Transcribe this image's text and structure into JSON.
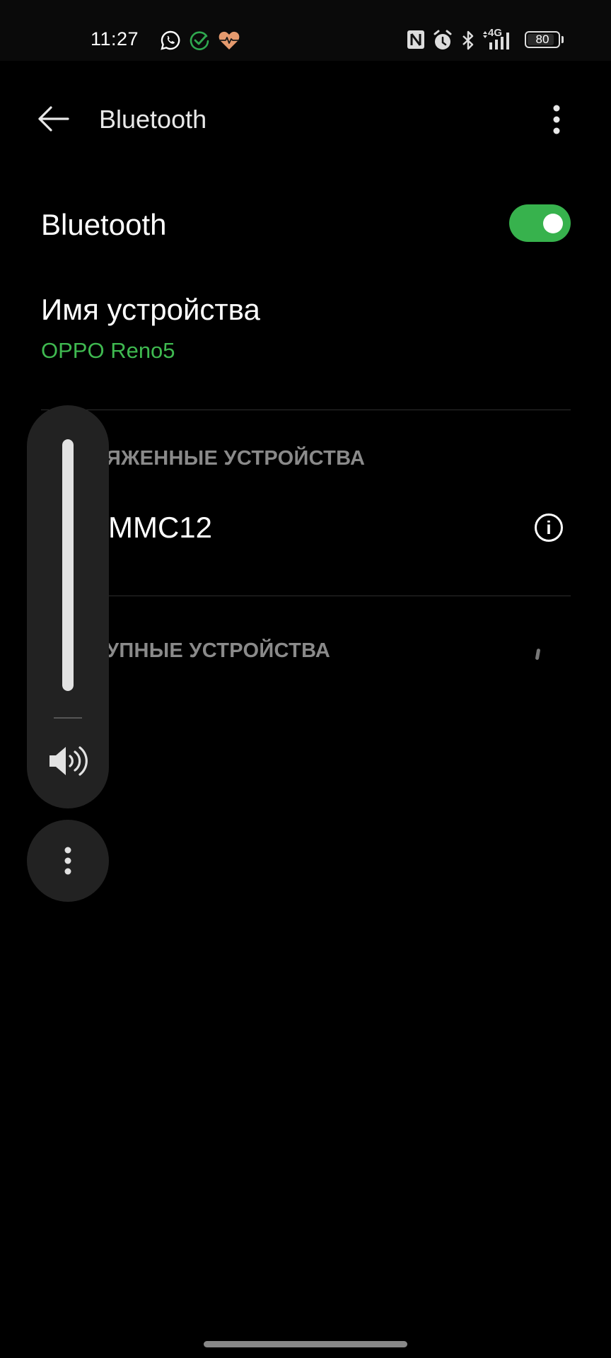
{
  "status_bar": {
    "time": "11:27",
    "notification_icons": [
      "whatsapp-icon",
      "check-circle-icon",
      "heart-rate-icon"
    ],
    "system_icons": [
      "nfc-icon",
      "alarm-icon",
      "bluetooth-icon",
      "4g-data-icon",
      "signal-icon"
    ],
    "network_label": "4G",
    "battery_level": "80",
    "colors": {
      "check": "#2fa84f",
      "heart": "#e59a6e"
    }
  },
  "header": {
    "title": "Bluetooth",
    "back_icon": "arrow-left-icon",
    "menu_icon": "more-vertical-icon"
  },
  "bluetooth_toggle": {
    "label": "Bluetooth",
    "enabled": true,
    "color": "#37b24d"
  },
  "device_name": {
    "label": "Имя устройства",
    "value": "OPPO Reno5",
    "value_color": "#3fb950"
  },
  "paired_section": {
    "heading": "ЯЖЕННЫЕ УСТРОЙСТВА",
    "devices": [
      {
        "name": "MMC12",
        "action_icon": "info-icon",
        "action_glyph": "i"
      }
    ]
  },
  "available_section": {
    "heading": "УПНЫЕ УСТРОЙСТВА",
    "loading_icon": "spinner-icon"
  },
  "volume_overlay": {
    "level_percent": 100,
    "speaker_icon": "speaker-icon",
    "more_icon": "more-vertical-icon"
  }
}
